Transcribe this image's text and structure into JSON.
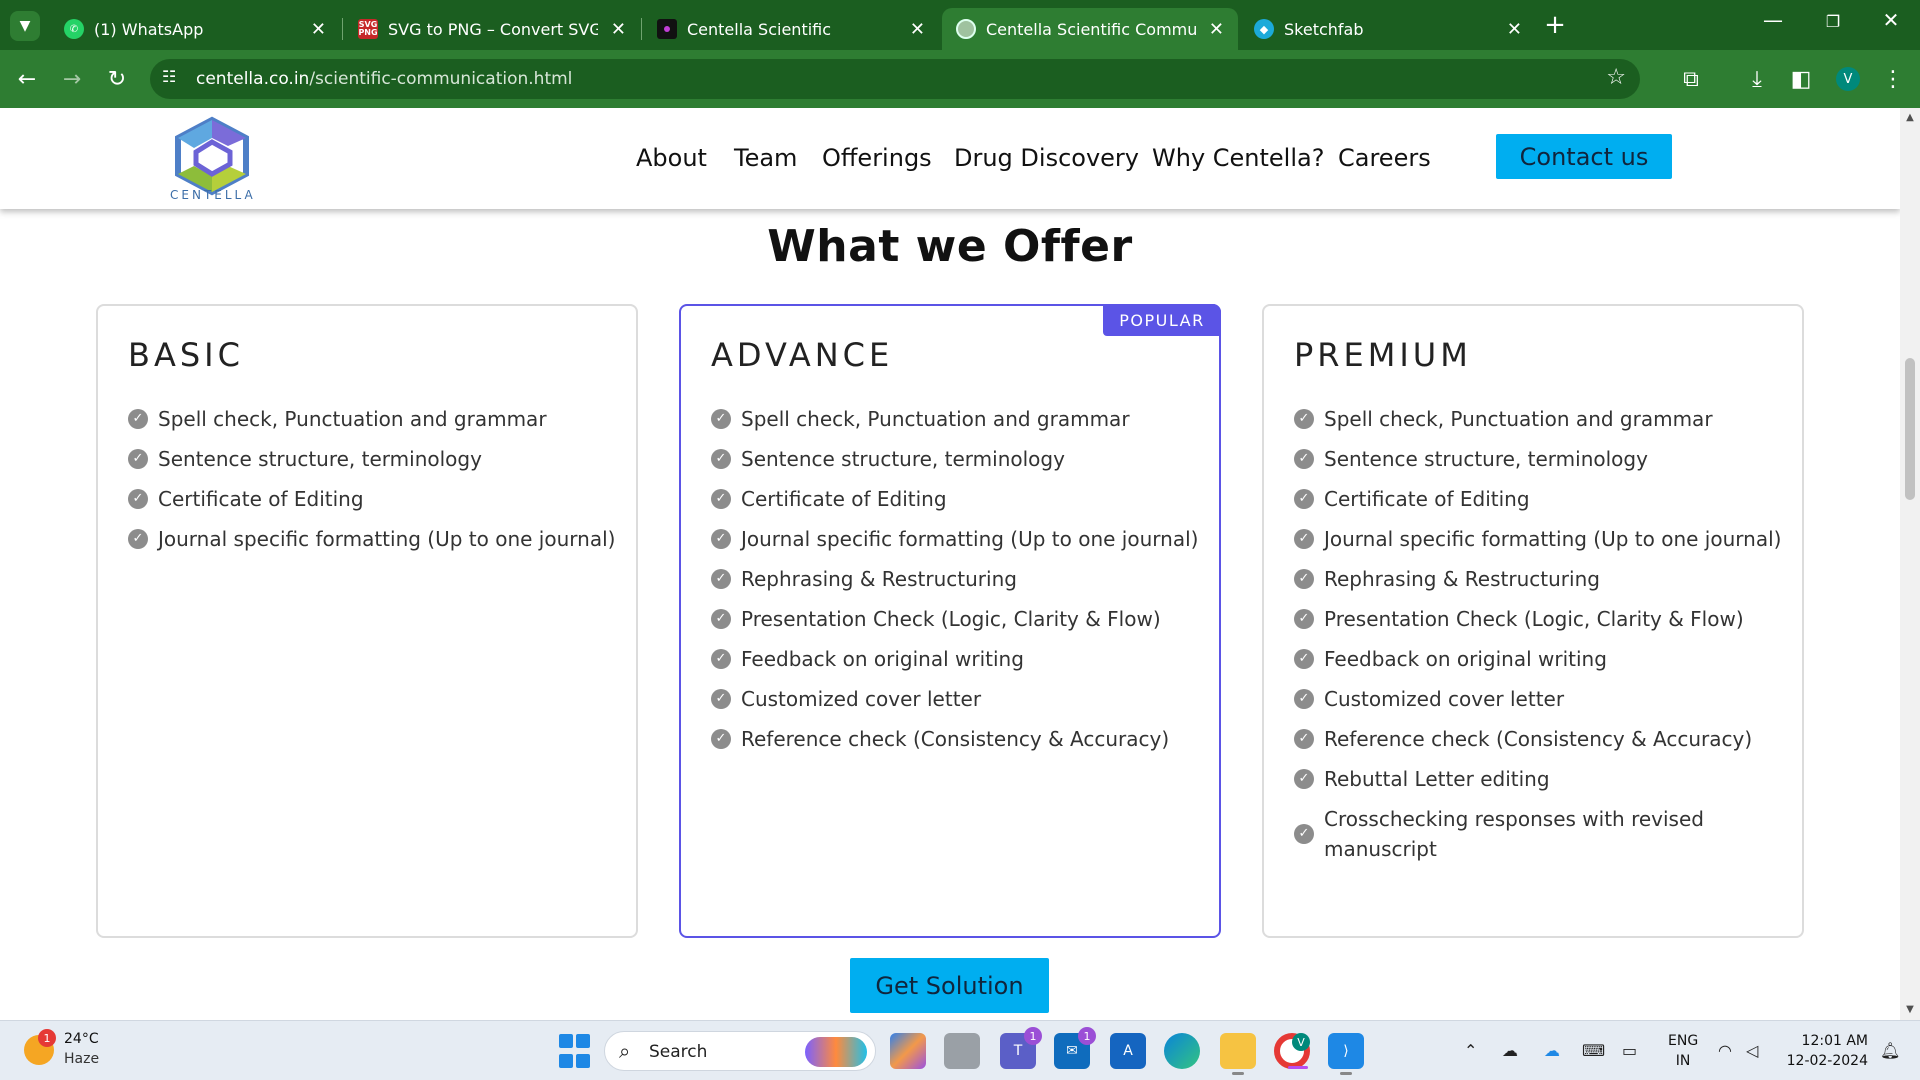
{
  "browser": {
    "tabs": [
      {
        "title": "(1) WhatsApp",
        "favicon": "whatsapp-icon"
      },
      {
        "title": "SVG to PNG – Convert SVG files",
        "favicon": "svg-png-icon",
        "favicon_text": "SVG PNG"
      },
      {
        "title": "Centella Scientific",
        "favicon": "centella-icon"
      },
      {
        "title": "Centella Scientific Communicati",
        "favicon": "globe-icon",
        "active": true
      },
      {
        "title": "Sketchfab",
        "favicon": "sketchfab-icon"
      }
    ],
    "url_host": "centella.co.in",
    "url_path": "/scientific-communication.html",
    "profile_initial": "V",
    "accent_color": "#2e7d32"
  },
  "site": {
    "logo_text": "CENTELLA",
    "nav": [
      "About",
      "Team",
      "Offerings",
      "Drug Discovery",
      "Why Centella?",
      "Careers"
    ],
    "contact_label": "Contact us",
    "section_title": "What we Offer",
    "cta_label": "Get Solution",
    "brand_color": "#00aef0",
    "popular_color": "#5b54e6",
    "plans": [
      {
        "name": "BASIC",
        "features": [
          "Spell check, Punctuation and grammar",
          "Sentence structure, terminology",
          "Certificate of Editing",
          "Journal specific formatting (Up to one journal)"
        ]
      },
      {
        "name": "ADVANCE",
        "badge": "POPULAR",
        "features": [
          "Spell check, Punctuation and grammar",
          "Sentence structure, terminology",
          "Certificate of Editing",
          "Journal specific formatting (Up to one journal)",
          "Rephrasing & Restructuring",
          "Presentation Check (Logic, Clarity & Flow)",
          "Feedback on original writing",
          "Customized cover letter",
          "Reference check (Consistency & Accuracy)"
        ]
      },
      {
        "name": "PREMIUM",
        "features": [
          "Spell check, Punctuation and grammar",
          "Sentence structure, terminology",
          "Certificate of Editing",
          "Journal specific formatting (Up to one journal)",
          "Rephrasing & Restructuring",
          "Presentation Check (Logic, Clarity & Flow)",
          "Feedback on original writing",
          "Customized cover letter",
          "Reference check (Consistency & Accuracy)",
          "Rebuttal Letter editing",
          "Crosschecking responses with revised manuscript"
        ]
      }
    ]
  },
  "taskbar": {
    "weather_temp": "24°C",
    "weather_desc": "Haze",
    "weather_badge": "1",
    "search_label": "Search",
    "teams_badge": "1",
    "mail_badge": "1",
    "chrome_badge": "V",
    "lang_line1": "ENG",
    "lang_line2": "IN",
    "time": "12:01 AM",
    "date": "12-02-2024",
    "apps": [
      "copilot-icon",
      "file-manager-icon",
      "teams-icon",
      "mail-icon",
      "azure-icon",
      "edge-icon",
      "folder-icon",
      "chrome-icon",
      "vscode-icon"
    ]
  }
}
